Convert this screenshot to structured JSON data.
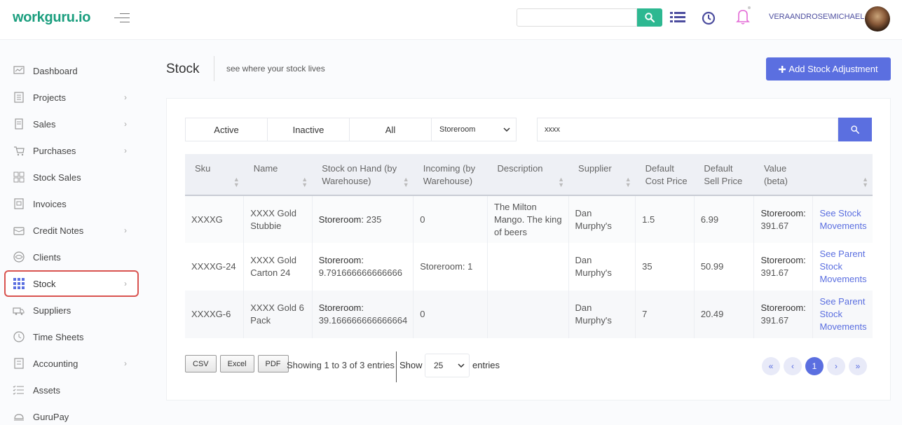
{
  "brand": {
    "logo": "workguru.io"
  },
  "topbar": {
    "search_value": "",
    "username": "VERAANDROSE\\MICHAEL"
  },
  "sidebar": {
    "items": [
      {
        "label": "Dashboard",
        "icon": "dashboard-icon",
        "chevron": false
      },
      {
        "label": "Projects",
        "icon": "projects-icon",
        "chevron": true
      },
      {
        "label": "Sales",
        "icon": "sales-icon",
        "chevron": true
      },
      {
        "label": "Purchases",
        "icon": "purchases-icon",
        "chevron": true
      },
      {
        "label": "Stock Sales",
        "icon": "stock-sales-icon",
        "chevron": false
      },
      {
        "label": "Invoices",
        "icon": "invoices-icon",
        "chevron": false
      },
      {
        "label": "Credit Notes",
        "icon": "credit-notes-icon",
        "chevron": true
      },
      {
        "label": "Clients",
        "icon": "clients-icon",
        "chevron": false
      },
      {
        "label": "Stock",
        "icon": "stock-grid-icon",
        "chevron": true,
        "active": true
      },
      {
        "label": "Suppliers",
        "icon": "suppliers-icon",
        "chevron": false
      },
      {
        "label": "Time Sheets",
        "icon": "timesheets-icon",
        "chevron": false
      },
      {
        "label": "Accounting",
        "icon": "accounting-icon",
        "chevron": true
      },
      {
        "label": "Assets",
        "icon": "assets-icon",
        "chevron": false
      },
      {
        "label": "GuruPay",
        "icon": "gurupay-icon",
        "chevron": false
      }
    ]
  },
  "page": {
    "title": "Stock",
    "subtitle": "see where your stock lives",
    "add_button": "Add Stock Adjustment"
  },
  "filters": {
    "tabs": [
      "Active",
      "Inactive",
      "All"
    ],
    "warehouse": "Storeroom",
    "search_value": "xxxx"
  },
  "table": {
    "headers": [
      "Sku",
      "Name",
      "Stock on Hand (by Warehouse)",
      "Incoming (by Warehouse)",
      "Description",
      "Supplier",
      "Default Cost Price",
      "Default Sell Price",
      "Value (beta)",
      ""
    ],
    "rows": [
      {
        "sku": "XXXXG",
        "name": "XXXX Gold Stubbie",
        "stock_label": "Storeroom:",
        "stock_value": "235",
        "incoming": "0",
        "description": "The Milton Mango. The king of beers",
        "supplier": "Dan Murphy's",
        "cost": "1.5",
        "sell": "6.99",
        "value_label": "Storeroom:",
        "value": "391.67",
        "action": "See Stock Movements"
      },
      {
        "sku": "XXXXG-24",
        "name": "XXXX Gold Carton 24",
        "stock_label": "Storeroom:",
        "stock_value": "9.791666666666666",
        "incoming": "Storeroom: 1",
        "description": "",
        "supplier": "Dan Murphy's",
        "cost": "35",
        "sell": "50.99",
        "value_label": "Storeroom:",
        "value": "391.67",
        "action": "See Parent Stock Movements"
      },
      {
        "sku": "XXXXG-6",
        "name": "XXXX Gold 6 Pack",
        "stock_label": "Storeroom:",
        "stock_value": "39.166666666666664",
        "incoming": "0",
        "description": "",
        "supplier": "Dan Murphy's",
        "cost": "7",
        "sell": "20.49",
        "value_label": "Storeroom:",
        "value": "391.67",
        "action": "See Parent Stock Movements"
      }
    ]
  },
  "footer": {
    "export_buttons": [
      "CSV",
      "Excel",
      "PDF"
    ],
    "showing": "Showing 1 to 3 of 3 entries",
    "show_label": "Show",
    "page_size": "25",
    "entries_label": "entries",
    "current_page": "1"
  },
  "colors": {
    "brand": "#1a9e7e",
    "accent": "#5b6fe0",
    "active_outline": "#d9534f"
  }
}
